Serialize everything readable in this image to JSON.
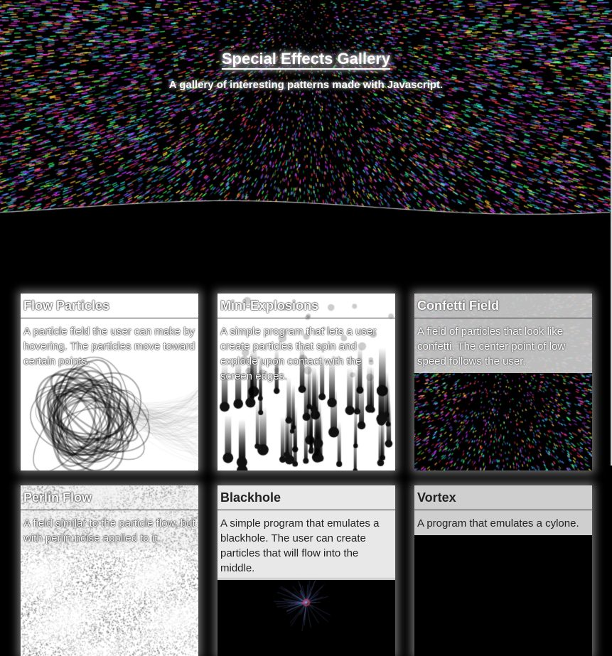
{
  "hero": {
    "title": "Special Effects Gallery",
    "subtitle": "A gallery of interesting patterns made with Javascript."
  },
  "cards": [
    {
      "title": "Flow Particles",
      "description": "A particle field the user can make by hovering. The particles move toward certain points."
    },
    {
      "title": "Mini-Explosions",
      "description": "A simple program that lets a user create particles that spin and explode upon contact with the screen edges."
    },
    {
      "title": "Confetti Field",
      "description": "A field of particles that look like confetti. The center point of low speed follows the user."
    },
    {
      "title": "Perlin Flow",
      "description": "A field similar to the particle flow, but with perlin noise applied to it."
    },
    {
      "title": "Blackhole",
      "description": "A simple program that emulates a blackhole. The user can create particles that will flow into the middle."
    },
    {
      "title": "Vortex",
      "description": "A program that emulates a cylone."
    }
  ],
  "colors": {
    "background": "#000000",
    "text": "#ffffff",
    "confetti": [
      "#ff3b3b",
      "#3bff5a",
      "#3b8bff",
      "#ff3bf0",
      "#ffe23b",
      "#3bf4ff",
      "#b03bff"
    ]
  }
}
